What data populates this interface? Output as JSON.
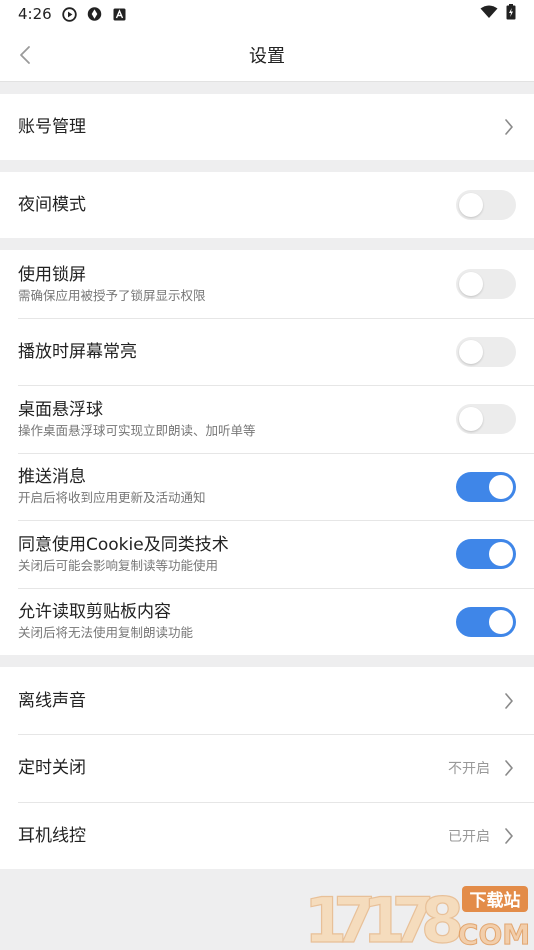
{
  "status_bar": {
    "time": "4:26"
  },
  "header": {
    "title": "设置"
  },
  "sections": [
    {
      "rows": [
        {
          "title": "账号管理",
          "type": "link"
        }
      ]
    },
    {
      "rows": [
        {
          "title": "夜间模式",
          "type": "toggle",
          "on": false
        }
      ]
    },
    {
      "rows": [
        {
          "title": "使用锁屏",
          "subtitle": "需确保应用被授予了锁屏显示权限",
          "type": "toggle",
          "on": false
        },
        {
          "title": "播放时屏幕常亮",
          "type": "toggle",
          "on": false
        },
        {
          "title": "桌面悬浮球",
          "subtitle": "操作桌面悬浮球可实现立即朗读、加听单等",
          "type": "toggle",
          "on": false
        },
        {
          "title": "推送消息",
          "subtitle": "开启后将收到应用更新及活动通知",
          "type": "toggle",
          "on": true
        },
        {
          "title": "同意使用Cookie及同类技术",
          "subtitle": "关闭后可能会影响复制读等功能使用",
          "type": "toggle",
          "on": true
        },
        {
          "title": "允许读取剪贴板内容",
          "subtitle": "关闭后将无法使用复制朗读功能",
          "type": "toggle",
          "on": true
        }
      ]
    },
    {
      "rows": [
        {
          "title": "离线声音",
          "type": "link"
        },
        {
          "title": "定时关闭",
          "value": "不开启",
          "type": "link"
        },
        {
          "title": "耳机线控",
          "value": "已开启",
          "type": "link"
        }
      ]
    }
  ],
  "watermark": {
    "digits": "17178",
    "badge": "下载站",
    "domain": "COM"
  },
  "colors": {
    "toggle_on": "#3f86e8",
    "toggle_off": "#ececec",
    "background": "#eeeeef"
  }
}
